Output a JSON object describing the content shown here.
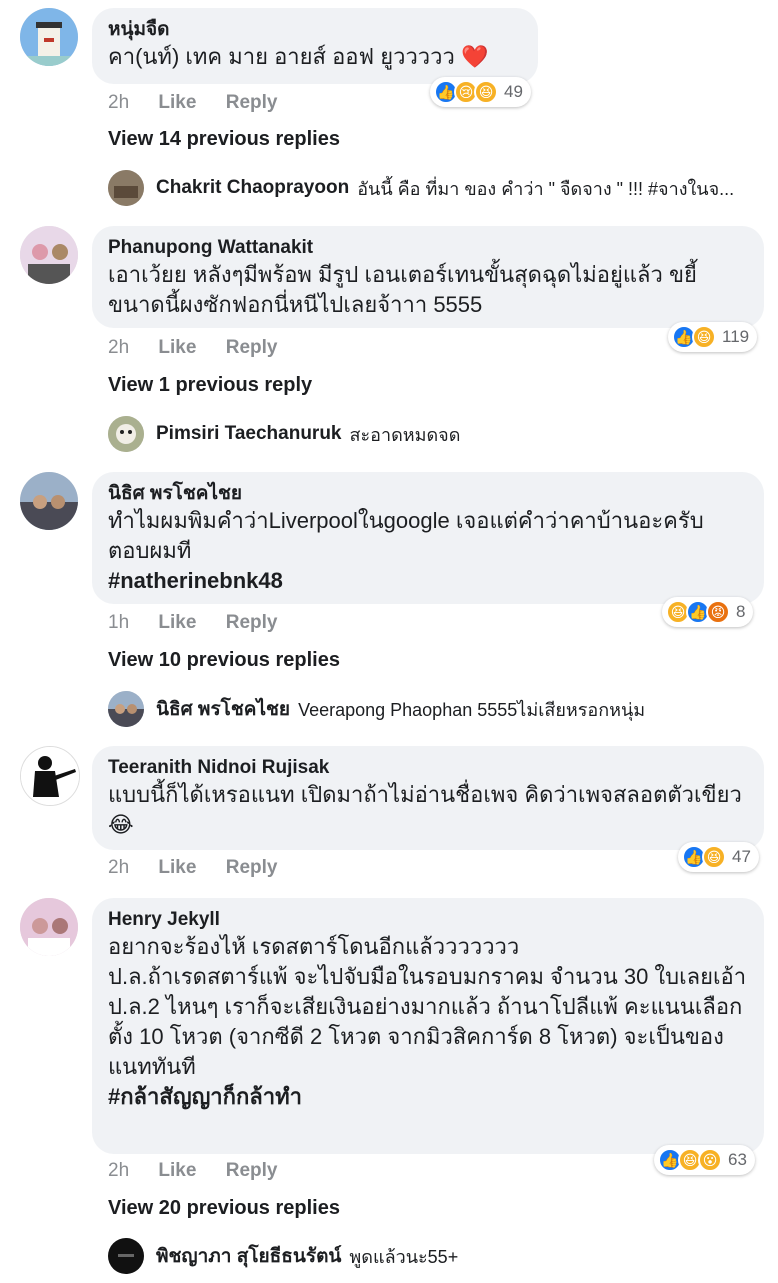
{
  "comments": [
    {
      "author": "หนุ่มจืด",
      "text": "คา(นท์) เทค มาย อายส์ ออฟ ยูววววว",
      "emoji": "❤️",
      "time": "2h",
      "like": "Like",
      "reply": "Reply",
      "reactions": [
        "like",
        "sad",
        "haha"
      ],
      "reaction_count": "49",
      "view_replies": "View 14 previous replies",
      "reply_preview": {
        "name": "Chakrit Chaoprayoon",
        "text": "อันนี้ คือ ที่มา ของ คำว่า \" จืดจาง \" !!! #จางในจ..."
      }
    },
    {
      "author": "Phanupong Wattanakit",
      "text": "เอาเว้ยย หลังๆมีพร้อพ มีรูป เอนเตอร์เทนขั้นสุดฉุดไม่อยู่แล้ว ขยี้ขนาดนี้ผงซักฟอกนี่หนีไปเลยจ้าาา 5555",
      "time": "2h",
      "like": "Like",
      "reply": "Reply",
      "reactions": [
        "like",
        "haha"
      ],
      "reaction_count": "119",
      "view_replies": "View 1 previous reply",
      "reply_preview": {
        "name": "Pimsiri Taechanuruk",
        "text": "สะอาดหมดจด"
      }
    },
    {
      "author": "นิธิศ พรโชคไชย",
      "text": "ทำไมผมพิมคำว่าLiverpoolในgoogle เจอแต่คำว่าคาบ้านอะครับ ตอบผมที",
      "hashtag": "#natherinebnk48",
      "time": "1h",
      "like": "Like",
      "reply": "Reply",
      "reactions": [
        "haha",
        "like",
        "angry"
      ],
      "reaction_count": "8",
      "view_replies": "View 10 previous replies",
      "reply_preview": {
        "name": "นิธิศ พรโชคไชย",
        "text": "Veerapong Phaophan 5555ไม่เสียหรอกหนุ่ม"
      }
    },
    {
      "author": "Teeranith Nidnoi Rujisak",
      "text": "แบบนี้ก็ได้เหรอแนท เปิดมาถ้าไม่อ่านชื่อเพจ คิดว่าเพจสลอตตัวเขียว",
      "emoji": "😂",
      "time": "2h",
      "like": "Like",
      "reply": "Reply",
      "reactions": [
        "like",
        "haha"
      ],
      "reaction_count": "47"
    },
    {
      "author": "Henry Jekyll",
      "text": "อยากจะร้องไห้ เรดสตาร์โดนอีกแล้ววววววว\nป.ล.ถ้าเรดสตาร์แพ้ จะไปจับมือในรอบมกราคม จำนวน 30 ใบเลยเอ้า\nป.ล.2 ไหนๆ เราก็จะเสียเงินอย่างมากแล้ว ถ้านาโปลีแพ้ คะแนนเลือกตั้ง 10 โหวต (จากซีดี 2 โหวต จากมิวสิคการ์ด 8 โหวต) จะเป็นของแนททันที",
      "hashtag": "#กล้าสัญญาก็กล้าทำ",
      "time": "2h",
      "like": "Like",
      "reply": "Reply",
      "reactions": [
        "like",
        "haha",
        "wow"
      ],
      "reaction_count": "63",
      "view_replies": "View 20 previous replies",
      "reply_preview": {
        "name": "พิชญาภา สุโยธีธนรัตน์",
        "text": "พูดแล้วนะ55+"
      }
    }
  ],
  "colors": {
    "like": "#1877f2",
    "haha": "#f7b125",
    "angry": "#e9710f",
    "bubble": "#f0f2f5"
  }
}
